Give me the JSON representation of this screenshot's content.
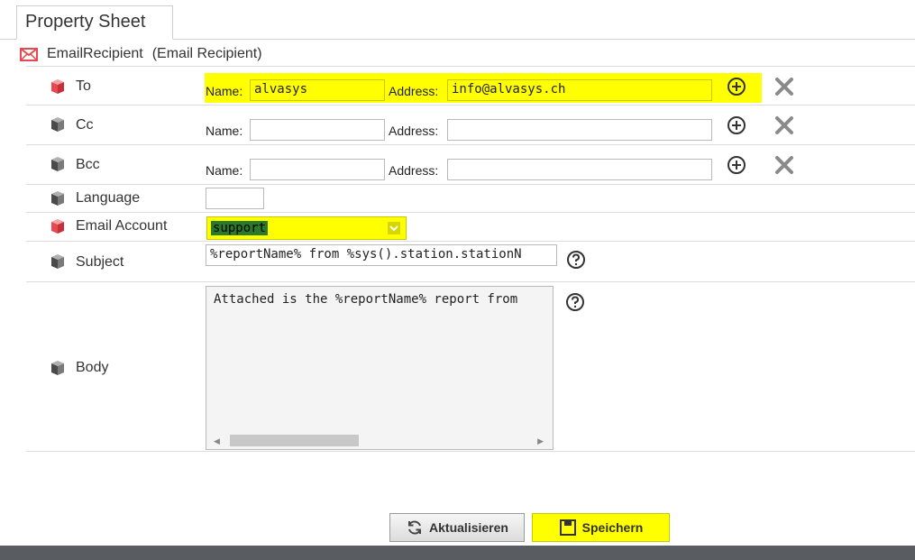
{
  "tab": {
    "label": "Property Sheet"
  },
  "header": {
    "name": "EmailRecipient",
    "type": "(Email Recipient)"
  },
  "rows": {
    "to": {
      "label": "To",
      "name_label": "Name:",
      "name_value": "alvasys",
      "address_label": "Address:",
      "address_value": "info@alvasys.ch"
    },
    "cc": {
      "label": "Cc",
      "name_label": "Name:",
      "name_value": "",
      "address_label": "Address:",
      "address_value": ""
    },
    "bcc": {
      "label": "Bcc",
      "name_label": "Name:",
      "name_value": "",
      "address_label": "Address:",
      "address_value": ""
    },
    "language": {
      "label": "Language",
      "value": ""
    },
    "email_account": {
      "label": "Email Account",
      "value": "support"
    },
    "subject": {
      "label": "Subject",
      "value": "%reportName% from %sys().station.stationN"
    },
    "body": {
      "label": "Body",
      "value": "Attached is the %reportName% report from"
    }
  },
  "buttons": {
    "refresh": "Aktualisieren",
    "save": "Speichern"
  },
  "colors": {
    "highlight": "#ffff00",
    "footer": "#595d62",
    "icon_red": "#e8484f",
    "icon_gray": "#5a5a5a"
  }
}
